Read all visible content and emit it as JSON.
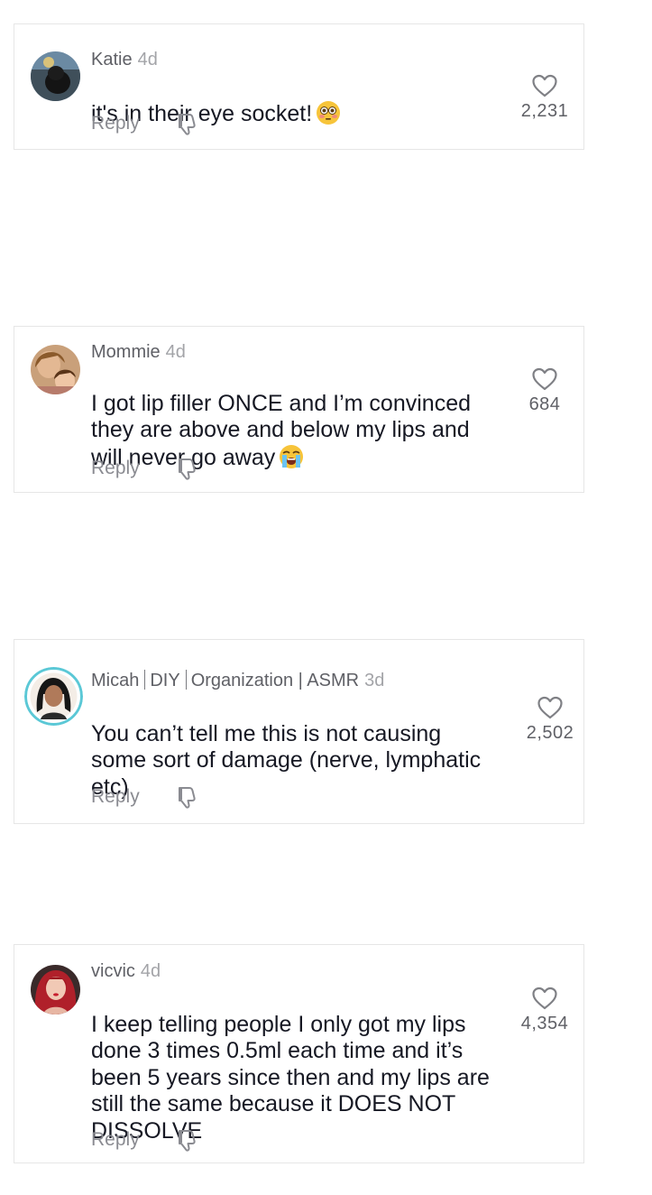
{
  "comments": [
    {
      "username": "Katie",
      "time": "4d",
      "text": "it's in their eye socket!",
      "emoji": "flushed-face-emoji",
      "reply_label": "Reply",
      "likes": "2,231"
    },
    {
      "username": "Mommie",
      "time": "4d",
      "text": "I got lip filler ONCE and I’m convinced\nthey are above and below my lips and\nwill never go away",
      "emoji": "loudly-crying-face-emoji",
      "reply_label": "Reply",
      "likes": "684"
    },
    {
      "username_parts": [
        "Micah",
        "DIY",
        "Organization | ASMR"
      ],
      "time": "3d",
      "text": "You can’t tell me this is not causing\nsome sort of damage (nerve, lymphatic\netc)",
      "reply_label": "Reply",
      "likes": "2,502"
    },
    {
      "username": "vicvic",
      "time": "4d",
      "text": "I keep telling people I only got my lips\ndone 3 times 0.5ml each time and it’s\nbeen 5 years since then and my lips are\nstill the same because it DOES NOT\nDISSOLVE",
      "reply_label": "Reply",
      "likes": "4,354"
    }
  ],
  "icons": {
    "like": "heart-outline-icon",
    "dislike": "thumbs-down-icon"
  },
  "colors": {
    "text": "#161823",
    "muted": "#8a8b91",
    "border": "#e6e6e6",
    "ring": "#5bc8d6"
  }
}
